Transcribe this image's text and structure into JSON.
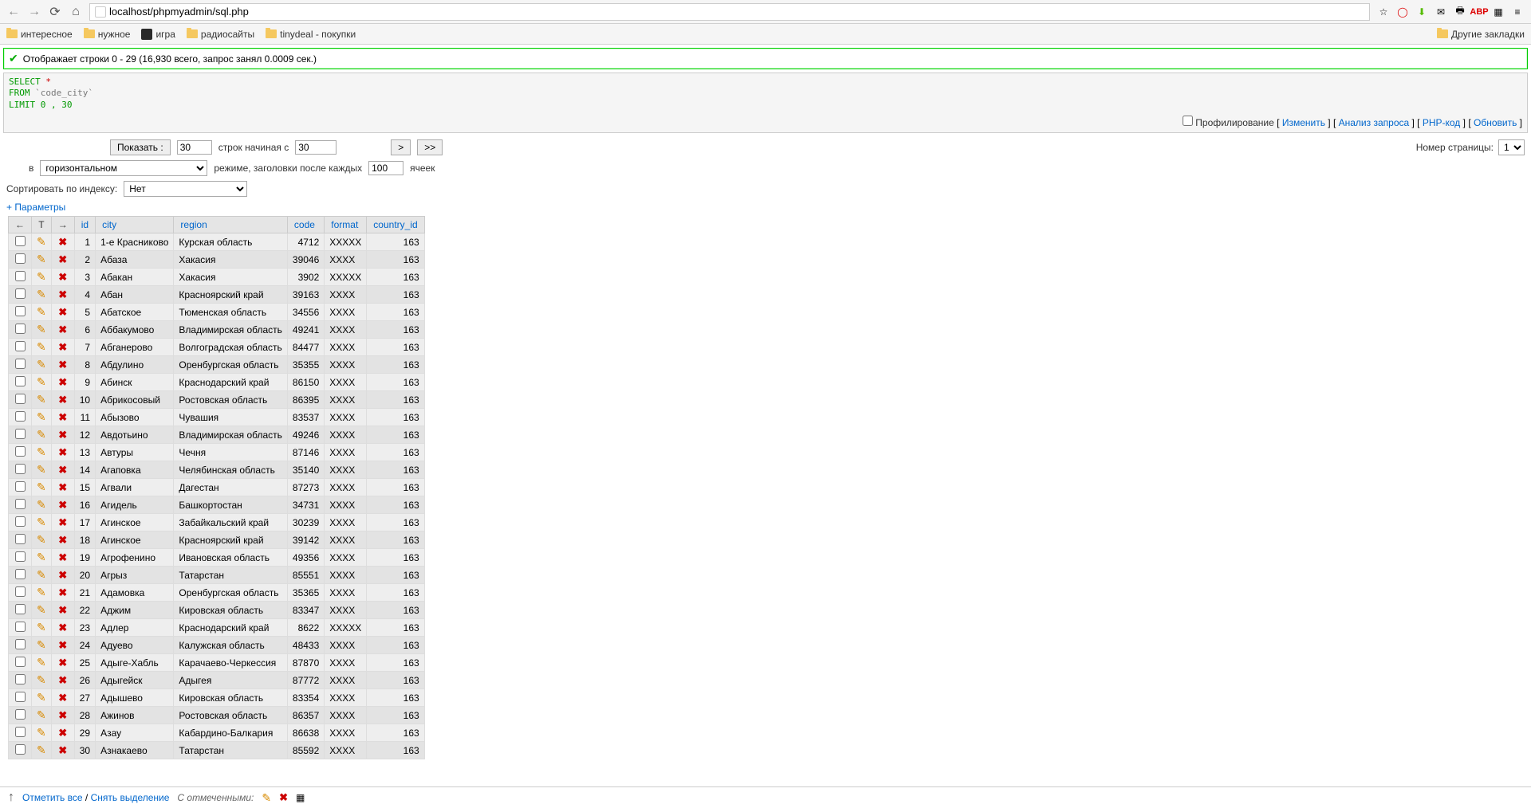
{
  "browser": {
    "url": "localhost/phpmyadmin/sql.php",
    "bookmarks": [
      "интересное",
      "нужное",
      "игра",
      "радиосайты",
      "tinydeal - покупки"
    ],
    "other_bookmarks": "Другие закладки"
  },
  "success_msg": "Отображает строки 0 - 29 (16,930 всего, запрос занял 0.0009 сек.)",
  "sql": {
    "select": "SELECT",
    "star": "*",
    "from": "FROM",
    "table": "`code_city`",
    "limit": "LIMIT 0 , 30"
  },
  "sql_links": {
    "profiling": "Профилирование",
    "edit": "Изменить",
    "analyze": "Анализ запроса",
    "php": "PHP-код",
    "refresh": "Обновить"
  },
  "controls": {
    "show_btn": "Показать :",
    "rows_value": "30",
    "rows_start_label": "строк начиная с",
    "start_value": "30",
    "next": ">",
    "last": ">>",
    "page_label": "Номер страницы:",
    "page_value": "1",
    "in_label": "в",
    "mode_value": "горизонтальном",
    "mode_suffix": "режиме, заголовки после каждых",
    "headers_value": "100",
    "cells_label": "ячеек",
    "sort_label": "Сортировать по индексу:",
    "sort_value": "Нет",
    "params": "Параметры"
  },
  "columns": {
    "id": "id",
    "city": "city",
    "region": "region",
    "code": "code",
    "format": "format",
    "country_id": "country_id"
  },
  "rows": [
    {
      "id": 1,
      "city": "1-е Красниково",
      "region": "Курская область",
      "code": 4712,
      "format": "XXXXX",
      "country_id": 163
    },
    {
      "id": 2,
      "city": "Абаза",
      "region": "Хакасия",
      "code": 39046,
      "format": "XXXX",
      "country_id": 163
    },
    {
      "id": 3,
      "city": "Абакан",
      "region": "Хакасия",
      "code": 3902,
      "format": "XXXXX",
      "country_id": 163
    },
    {
      "id": 4,
      "city": "Абан",
      "region": "Красноярский край",
      "code": 39163,
      "format": "XXXX",
      "country_id": 163
    },
    {
      "id": 5,
      "city": "Абатское",
      "region": "Тюменская область",
      "code": 34556,
      "format": "XXXX",
      "country_id": 163
    },
    {
      "id": 6,
      "city": "Аббакумово",
      "region": "Владимирская область",
      "code": 49241,
      "format": "XXXX",
      "country_id": 163
    },
    {
      "id": 7,
      "city": "Абганерово",
      "region": "Волгоградская область",
      "code": 84477,
      "format": "XXXX",
      "country_id": 163
    },
    {
      "id": 8,
      "city": "Абдулино",
      "region": "Оренбургская область",
      "code": 35355,
      "format": "XXXX",
      "country_id": 163
    },
    {
      "id": 9,
      "city": "Абинск",
      "region": "Краснодарский край",
      "code": 86150,
      "format": "XXXX",
      "country_id": 163
    },
    {
      "id": 10,
      "city": "Абрикосовый",
      "region": "Ростовская область",
      "code": 86395,
      "format": "XXXX",
      "country_id": 163
    },
    {
      "id": 11,
      "city": "Абызово",
      "region": "Чувашия",
      "code": 83537,
      "format": "XXXX",
      "country_id": 163
    },
    {
      "id": 12,
      "city": "Авдотьино",
      "region": "Владимирская область",
      "code": 49246,
      "format": "XXXX",
      "country_id": 163
    },
    {
      "id": 13,
      "city": "Автуры",
      "region": "Чечня",
      "code": 87146,
      "format": "XXXX",
      "country_id": 163
    },
    {
      "id": 14,
      "city": "Агаповка",
      "region": "Челябинская область",
      "code": 35140,
      "format": "XXXX",
      "country_id": 163
    },
    {
      "id": 15,
      "city": "Агвали",
      "region": "Дагестан",
      "code": 87273,
      "format": "XXXX",
      "country_id": 163
    },
    {
      "id": 16,
      "city": "Агидель",
      "region": "Башкортостан",
      "code": 34731,
      "format": "XXXX",
      "country_id": 163
    },
    {
      "id": 17,
      "city": "Агинское",
      "region": "Забайкальский край",
      "code": 30239,
      "format": "XXXX",
      "country_id": 163
    },
    {
      "id": 18,
      "city": "Агинское",
      "region": "Красноярский край",
      "code": 39142,
      "format": "XXXX",
      "country_id": 163
    },
    {
      "id": 19,
      "city": "Агрофенино",
      "region": "Ивановская область",
      "code": 49356,
      "format": "XXXX",
      "country_id": 163
    },
    {
      "id": 20,
      "city": "Агрыз",
      "region": "Татарстан",
      "code": 85551,
      "format": "XXXX",
      "country_id": 163
    },
    {
      "id": 21,
      "city": "Адамовка",
      "region": "Оренбургская область",
      "code": 35365,
      "format": "XXXX",
      "country_id": 163
    },
    {
      "id": 22,
      "city": "Аджим",
      "region": "Кировская область",
      "code": 83347,
      "format": "XXXX",
      "country_id": 163
    },
    {
      "id": 23,
      "city": "Адлер",
      "region": "Краснодарский край",
      "code": 8622,
      "format": "XXXXX",
      "country_id": 163
    },
    {
      "id": 24,
      "city": "Адуево",
      "region": "Калужская область",
      "code": 48433,
      "format": "XXXX",
      "country_id": 163
    },
    {
      "id": 25,
      "city": "Адыге-Хабль",
      "region": "Карачаево-Черкессия",
      "code": 87870,
      "format": "XXXX",
      "country_id": 163
    },
    {
      "id": 26,
      "city": "Адыгейск",
      "region": "Адыгея",
      "code": 87772,
      "format": "XXXX",
      "country_id": 163
    },
    {
      "id": 27,
      "city": "Адышево",
      "region": "Кировская область",
      "code": 83354,
      "format": "XXXX",
      "country_id": 163
    },
    {
      "id": 28,
      "city": "Ажинов",
      "region": "Ростовская область",
      "code": 86357,
      "format": "XXXX",
      "country_id": 163
    },
    {
      "id": 29,
      "city": "Азау",
      "region": "Кабардино-Балкария",
      "code": 86638,
      "format": "XXXX",
      "country_id": 163
    },
    {
      "id": 30,
      "city": "Азнакаево",
      "region": "Татарстан",
      "code": 85592,
      "format": "XXXX",
      "country_id": 163
    }
  ],
  "footer": {
    "check_all": "Отметить все",
    "uncheck_all": "Снять выделение",
    "with_selected": "С отмеченными:"
  }
}
